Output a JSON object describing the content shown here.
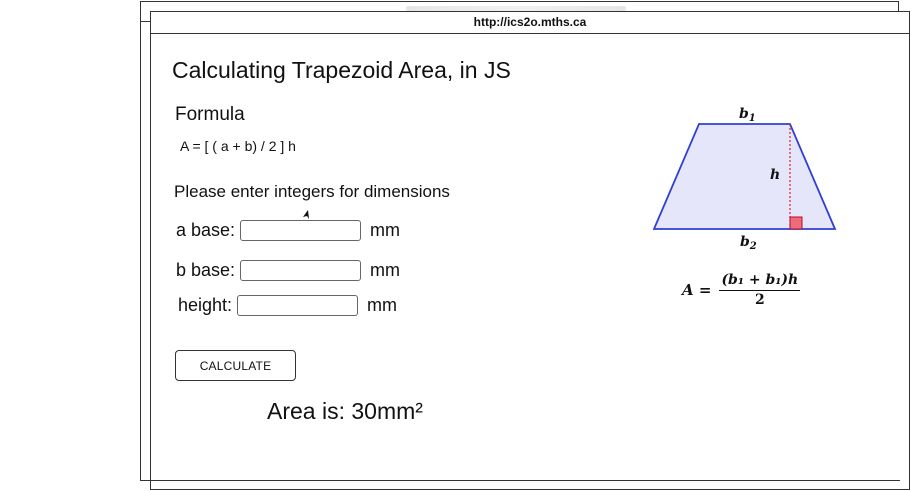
{
  "window": {
    "url": "http://ics2o.mths.ca"
  },
  "page": {
    "title": "Calculating Trapezoid Area, in JS",
    "formula_heading": "Formula",
    "formula_text": "A = [ ( a + b) / 2 ] h",
    "instructions": "Please enter integers for dimensions"
  },
  "form": {
    "a_base": {
      "label": "a base:",
      "value": "",
      "unit": "mm"
    },
    "b_base": {
      "label": "b base:",
      "value": "",
      "unit": "mm"
    },
    "height": {
      "label": "height:",
      "value": "",
      "unit": "mm"
    },
    "calculate_label": "CALCULATE"
  },
  "result": {
    "text": "Area is: 30mm²"
  },
  "diagram": {
    "top_label": "b",
    "top_sub": "1",
    "bottom_label": "b",
    "bottom_sub": "2",
    "height_label": "h",
    "formula_lhs": "A =",
    "formula_num": "(b₁ + b₁)h",
    "formula_den": "2",
    "fill_color": "#e6e6fb",
    "stroke_color": "#2f3fd6",
    "height_line_color": "#dd2222",
    "right_angle_color": "#ef6b7a"
  },
  "icons": {
    "cursor": "mouse-cursor-icon"
  }
}
